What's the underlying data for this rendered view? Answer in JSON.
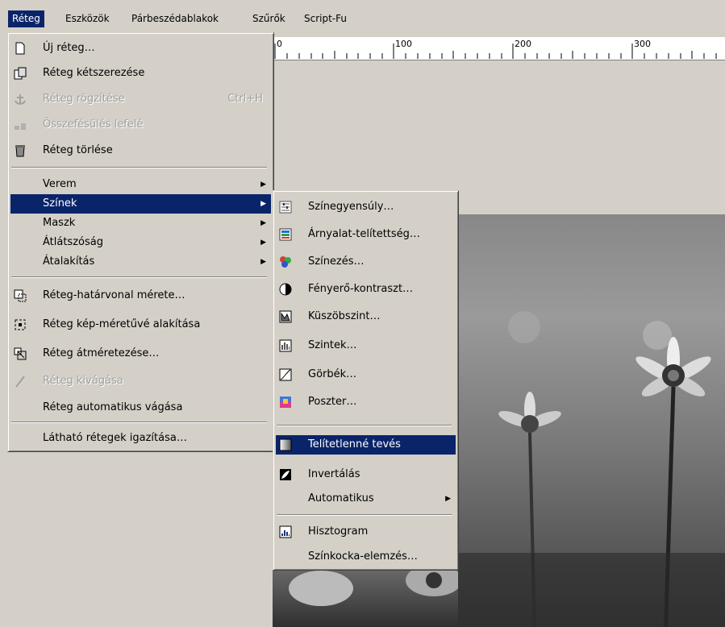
{
  "menubar": [
    "Réteg",
    "Eszközök",
    "Párbeszédablakok",
    "Szűrők",
    "Script-Fu"
  ],
  "ruler": [
    "0",
    "100",
    "200",
    "300"
  ],
  "layer_menu": {
    "items": [
      {
        "label": "Új réteg…",
        "icon": "new-layer-icon"
      },
      {
        "label": "Réteg kétszerezése",
        "icon": "duplicate-layer-icon"
      },
      {
        "label": "Réteg rögzítése",
        "shortcut": "Ctrl+H",
        "icon": "anchor-icon",
        "disabled": true
      },
      {
        "label": "Összefésülés lefelé",
        "icon": "merge-down-icon",
        "disabled": true
      },
      {
        "label": "Réteg törlése",
        "icon": "delete-layer-icon"
      },
      {
        "label": "Verem",
        "submenu": true
      },
      {
        "label": "Színek",
        "submenu": true,
        "highlighted": true
      },
      {
        "label": "Maszk",
        "submenu": true
      },
      {
        "label": "Átlátszóság",
        "submenu": true
      },
      {
        "label": "Átalakítás",
        "submenu": true
      },
      {
        "label": "Réteg-határvonal mérete…",
        "icon": "layer-boundary-icon"
      },
      {
        "label": "Réteg kép-méretűvé alakítása",
        "icon": "layer-to-image-size-icon"
      },
      {
        "label": "Réteg átméretezése…",
        "icon": "scale-layer-icon"
      },
      {
        "label": "Réteg kivágása",
        "icon": "crop-icon",
        "disabled": true
      },
      {
        "label": "Réteg automatikus vágása"
      },
      {
        "label": "Látható rétegek igazítása…"
      }
    ]
  },
  "colors_menu": {
    "items": [
      {
        "label": "Színegyensúly…",
        "icon": "color-balance-icon"
      },
      {
        "label": "Árnyalat-telítettség…",
        "icon": "hue-saturation-icon"
      },
      {
        "label": "Színezés…",
        "icon": "colorize-icon"
      },
      {
        "label": "Fényerő-kontraszt…",
        "icon": "brightness-contrast-icon"
      },
      {
        "label": "Küszöbszint…",
        "icon": "threshold-icon"
      },
      {
        "label": "Szintek…",
        "icon": "levels-icon"
      },
      {
        "label": "Görbék…",
        "icon": "curves-icon"
      },
      {
        "label": "Poszter…",
        "icon": "posterize-icon"
      },
      {
        "label": "Telítetlenné tevés",
        "icon": "desaturate-icon",
        "highlighted": true
      },
      {
        "label": "Invertálás",
        "icon": "invert-icon"
      },
      {
        "label": "Automatikus",
        "submenu": true
      },
      {
        "label": "Hisztogram",
        "icon": "histogram-icon"
      },
      {
        "label": "Színkocka-elemzés…"
      }
    ]
  },
  "colors": {
    "highlight": "#0a246a",
    "menu_bg": "#d4d0c8"
  }
}
